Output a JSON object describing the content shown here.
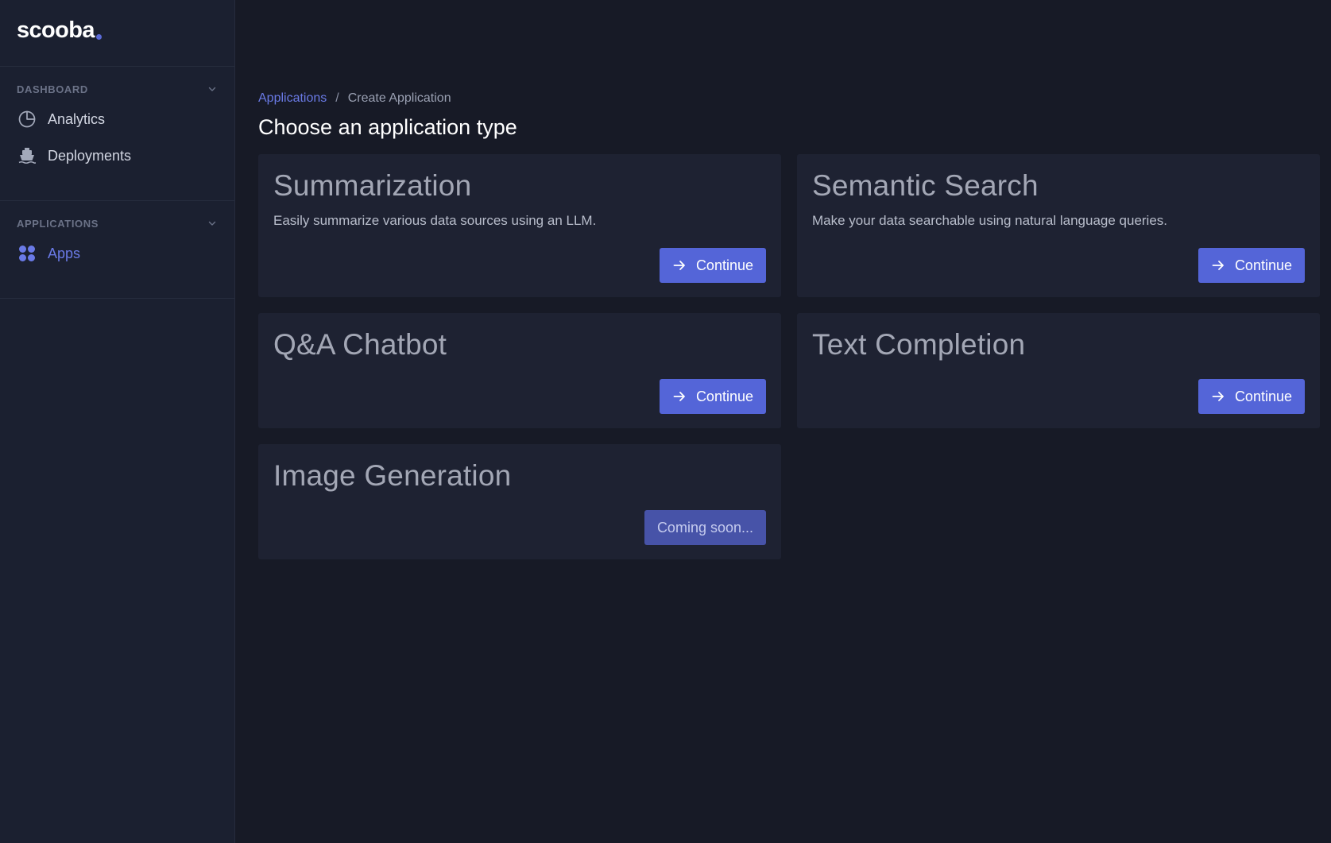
{
  "app": {
    "logo_text": "scooba",
    "accent_color": "#5465d8"
  },
  "sidebar": {
    "sections": [
      {
        "title": "DASHBOARD",
        "items": [
          {
            "label": "Analytics",
            "icon": "pie-chart-icon"
          },
          {
            "label": "Deployments",
            "icon": "ship-icon"
          }
        ]
      },
      {
        "title": "APPLICATIONS",
        "items": [
          {
            "label": "Apps",
            "icon": "apps-grid-icon",
            "active": true
          }
        ]
      }
    ]
  },
  "breadcrumb": {
    "link": "Applications",
    "separator": "/",
    "current": "Create Application"
  },
  "page": {
    "title": "Choose an application type"
  },
  "cards": [
    {
      "title": "Summarization",
      "description": "Easily summarize various data sources using an LLM.",
      "button": "Continue",
      "icon": "arrow-right-icon"
    },
    {
      "title": "Semantic Search",
      "description": "Make your data searchable using natural language queries.",
      "button": "Continue",
      "icon": "arrow-right-icon"
    },
    {
      "title": "Q&A Chatbot",
      "description": "",
      "button": "Continue",
      "icon": "arrow-right-icon"
    },
    {
      "title": "Text Completion",
      "description": "",
      "button": "Continue",
      "icon": "arrow-right-icon"
    },
    {
      "title": "Image Generation",
      "description": "",
      "button": "Coming soon...",
      "disabled": true
    }
  ]
}
